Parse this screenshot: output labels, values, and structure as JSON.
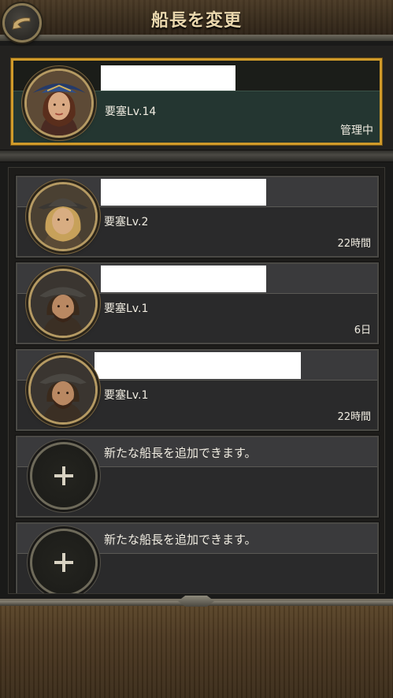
{
  "header": {
    "title": "船長を変更",
    "back_icon": "back-arrow-icon"
  },
  "active_captain": {
    "level": "要塞Lv.14",
    "status": "管理中"
  },
  "captains": [
    {
      "level": "要塞Lv.2",
      "meta": "22時間"
    },
    {
      "level": "要塞Lv.1",
      "meta": "6日"
    },
    {
      "level": "要塞Lv.1",
      "meta": "22時間"
    }
  ],
  "add_slots": [
    {
      "label": "新たな船長を追加できます。"
    },
    {
      "label": "新たな船長を追加できます。"
    }
  ],
  "colors": {
    "accent_gold": "#d09a2a",
    "header_title": "#ead7ad"
  }
}
